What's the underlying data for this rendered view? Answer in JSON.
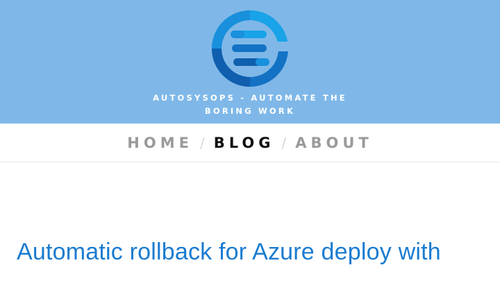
{
  "header": {
    "logo_icon": "autosysops-logo-icon",
    "site_title": "AUTOSYSOPS - AUTOMATE THE BORING WORK",
    "background_color": "#7fb8e8"
  },
  "nav": {
    "items": [
      {
        "label": "HOME",
        "active": false
      },
      {
        "label": "BLOG",
        "active": true
      },
      {
        "label": "ABOUT",
        "active": false
      }
    ],
    "separator": "/"
  },
  "post": {
    "title": "Automatic rollback for Azure deploy with",
    "title_color": "#1a7bd0"
  }
}
